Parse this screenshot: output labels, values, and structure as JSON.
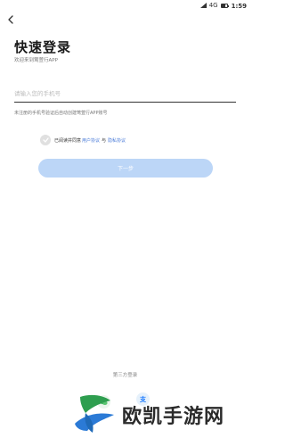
{
  "status_bar": {
    "network": "4G",
    "time": "1:59",
    "battery_level": 0.8
  },
  "header": {
    "back_icon": "chevron-left-icon"
  },
  "login": {
    "title": "快速登录",
    "subtitle": "欢迎来到莺萱行APP",
    "phone_placeholder": "请输入您的手机号",
    "phone_value": "",
    "hint": "未注册的手机号验证后自动创建莺萱行APP账号",
    "agreement": {
      "prefix": "已阅读并同意",
      "user_agreement": "用户协议",
      "conjunction": "与",
      "privacy_policy": "隐私协议",
      "checked": true
    },
    "next_button": "下一步"
  },
  "third_party": {
    "label": "第三方登录",
    "icons": [
      "wechat-icon",
      "alipay-icon"
    ],
    "alipay_glyph": "支"
  },
  "watermark": {
    "text": "欧凯手游网"
  },
  "colors": {
    "primary_button": "#bcd6f7",
    "link": "#4a7bd8",
    "text_dark": "#1a1a1a",
    "text_muted": "#777777"
  }
}
